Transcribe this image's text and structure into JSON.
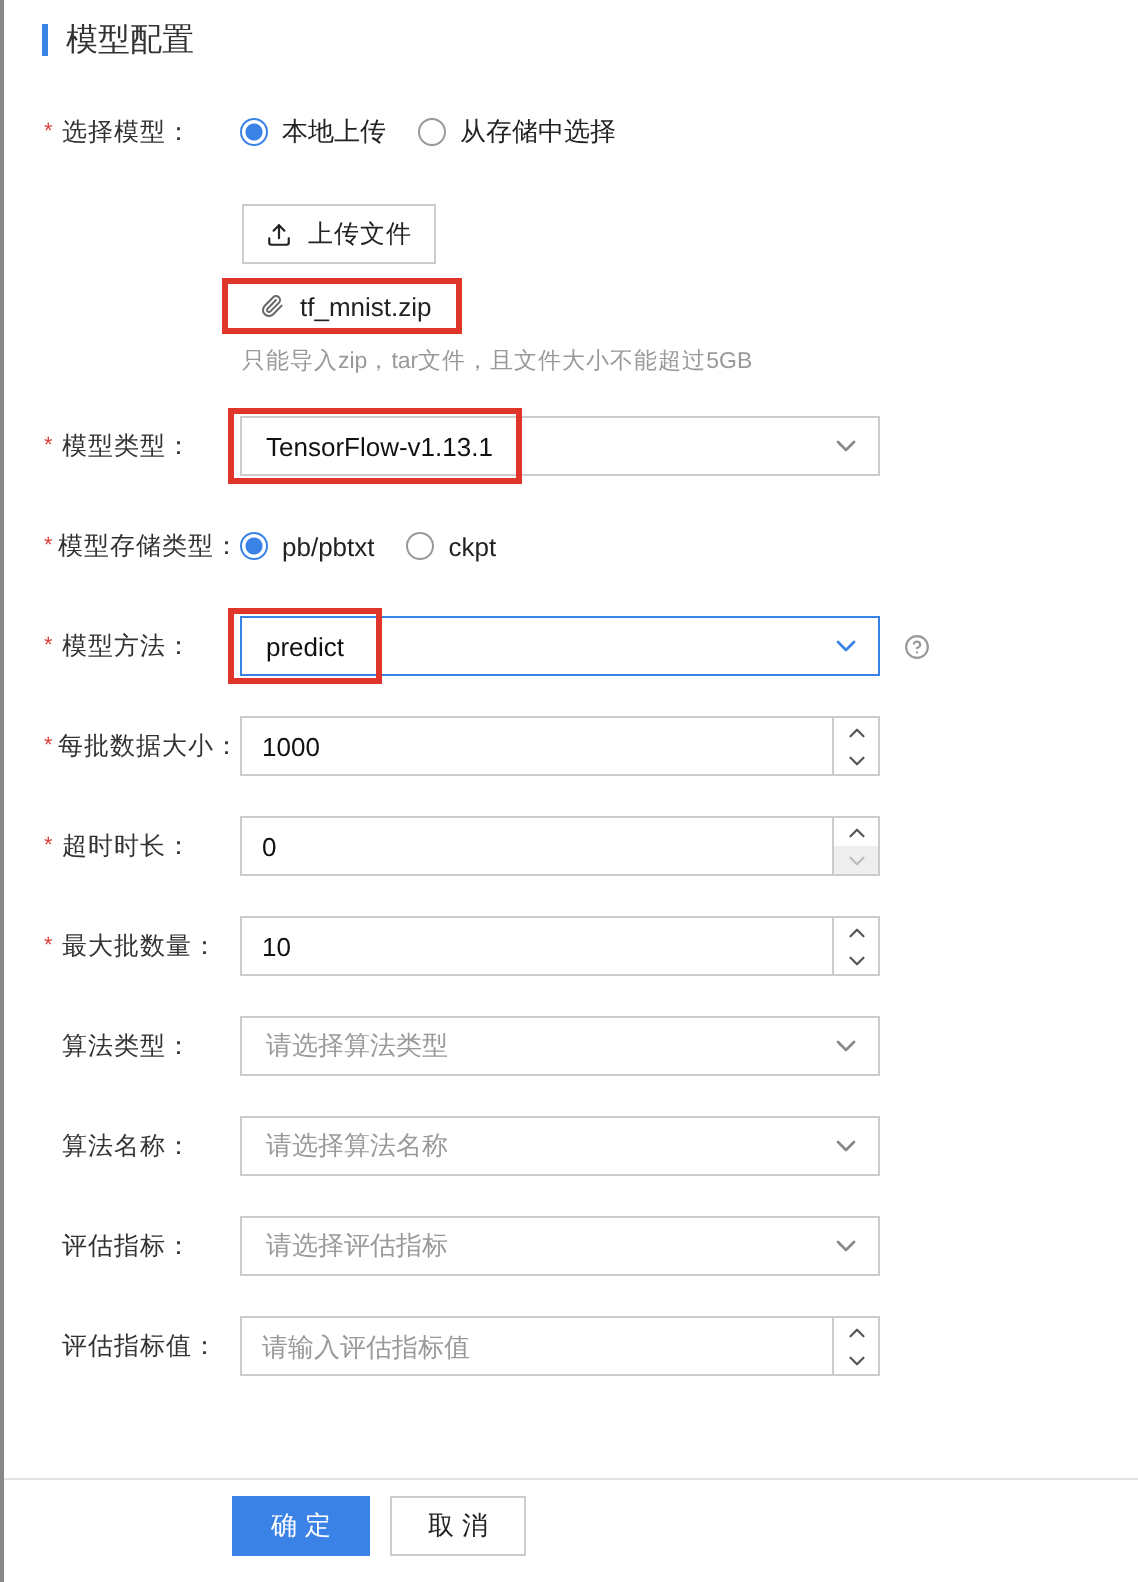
{
  "title": "模型配置",
  "fields": [
    {
      "kind": "radio",
      "label": "选择模型：",
      "required_mark": "*",
      "options": [
        {
          "label": "本地上传",
          "selected": true
        },
        {
          "label": "从存储中选择",
          "selected": false
        }
      ]
    },
    {
      "kind": "upload",
      "button": "上传文件",
      "file": "tf_mnist.zip",
      "hint": "只能导入zip，tar文件，且文件大小不能超过5GB",
      "highlighted": true
    },
    {
      "kind": "select",
      "label": "模型类型：",
      "required_mark": "*",
      "value": "TensorFlow-v1.13.1",
      "highlighted": true,
      "focused": false
    },
    {
      "kind": "radio",
      "label": "模型存储类型：",
      "required_mark": "*",
      "options": [
        {
          "label": "pb/pbtxt",
          "selected": true
        },
        {
          "label": "ckpt",
          "selected": false
        }
      ]
    },
    {
      "kind": "select",
      "label": "模型方法：",
      "required_mark": "*",
      "value": "predict",
      "highlighted": true,
      "focused": true,
      "help": true
    },
    {
      "kind": "number",
      "label": "每批数据大小：",
      "required_mark": "*",
      "value": "1000",
      "down_disabled": false
    },
    {
      "kind": "number",
      "label": "超时时长：",
      "required_mark": "*",
      "value": "0",
      "down_disabled": true
    },
    {
      "kind": "number",
      "label": "最大批数量：",
      "required_mark": "*",
      "value": "10",
      "down_disabled": false
    },
    {
      "kind": "select",
      "label": "算法类型：",
      "placeholder": "请选择算法类型",
      "focused": false
    },
    {
      "kind": "select",
      "label": "算法名称：",
      "placeholder": "请选择算法名称",
      "focused": false
    },
    {
      "kind": "select",
      "label": "评估指标：",
      "placeholder": "请选择评估指标",
      "focused": false
    },
    {
      "kind": "number",
      "label": "评估指标值：",
      "placeholder": "请输入评估指标值",
      "down_disabled": false
    }
  ],
  "buttons": [
    {
      "label": "确 定",
      "primary": true
    },
    {
      "label": "取 消",
      "primary": false
    }
  ]
}
